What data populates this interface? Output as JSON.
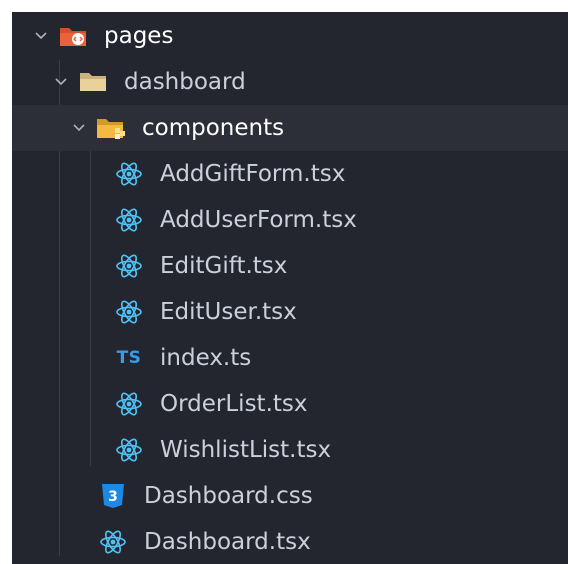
{
  "tree": {
    "items": [
      {
        "label": "pages",
        "type": "folder",
        "icon": "pages-folder-icon",
        "expanded": true
      },
      {
        "label": "dashboard",
        "type": "folder",
        "icon": "folder-icon",
        "expanded": true
      },
      {
        "label": "components",
        "type": "folder",
        "icon": "components-folder-icon",
        "expanded": true
      },
      {
        "label": "AddGiftForm.tsx",
        "type": "file",
        "icon": "react-icon"
      },
      {
        "label": "AddUserForm.tsx",
        "type": "file",
        "icon": "react-icon"
      },
      {
        "label": "EditGift.tsx",
        "type": "file",
        "icon": "react-icon"
      },
      {
        "label": "EditUser.tsx",
        "type": "file",
        "icon": "react-icon"
      },
      {
        "label": "index.ts",
        "type": "file",
        "icon": "typescript-icon",
        "badge": "TS"
      },
      {
        "label": "OrderList.tsx",
        "type": "file",
        "icon": "react-icon"
      },
      {
        "label": "WishlistList.tsx",
        "type": "file",
        "icon": "react-icon"
      },
      {
        "label": "Dashboard.css",
        "type": "file",
        "icon": "css-icon",
        "badge": "3"
      },
      {
        "label": "Dashboard.tsx",
        "type": "file",
        "icon": "react-icon"
      }
    ]
  },
  "colors": {
    "background": "#24262f",
    "react": "#4fc3f7",
    "typescript": "#3a9be8",
    "css": "#1e88e5",
    "folder": "#e8d29a",
    "pages_folder": "#e8623a",
    "components_folder": "#f4b942"
  }
}
